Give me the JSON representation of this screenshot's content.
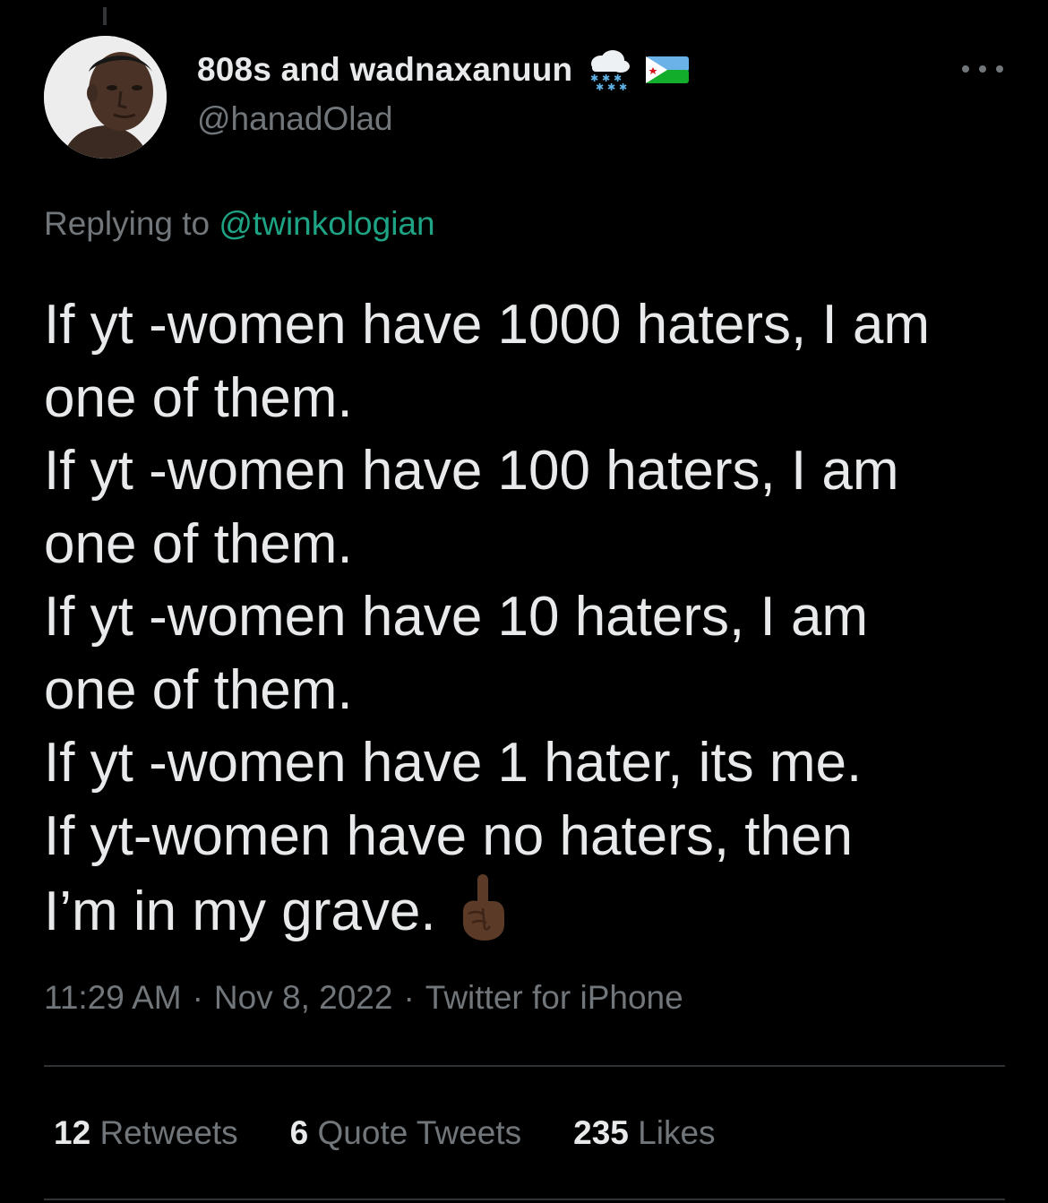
{
  "author": {
    "display_name": "808s and wadnaxanuun",
    "handle": "@hanadOlad",
    "name_emojis": [
      "cloud-with-snow-icon",
      "djibouti-flag-icon"
    ]
  },
  "reply": {
    "prefix": "Replying to",
    "mention": "@twinkologian"
  },
  "tweet": {
    "lines": [
      "If yt -women have 1000 haters, I am",
      "one of them.",
      "If yt -women have 100 haters, I am",
      "one of them.",
      "If yt -women have 10 haters, I am",
      "one of them.",
      "If yt -women have 1 hater, its me.",
      "If yt-women have no haters, then",
      "I’m in my grave."
    ],
    "trailing_emoji": "index-pointing-up-icon"
  },
  "meta": {
    "time": "11:29 AM",
    "date": "Nov 8, 2022",
    "source": "Twitter for iPhone",
    "separator": "·"
  },
  "stats": {
    "retweets": {
      "count": "12",
      "label": "Retweets"
    },
    "quotes": {
      "count": "6",
      "label": "Quote Tweets"
    },
    "likes": {
      "count": "235",
      "label": "Likes"
    }
  },
  "colors": {
    "background": "#000000",
    "text": "#e7e9ea",
    "secondary": "#71767b",
    "mention": "#1ea484",
    "divider": "#2f3336"
  }
}
